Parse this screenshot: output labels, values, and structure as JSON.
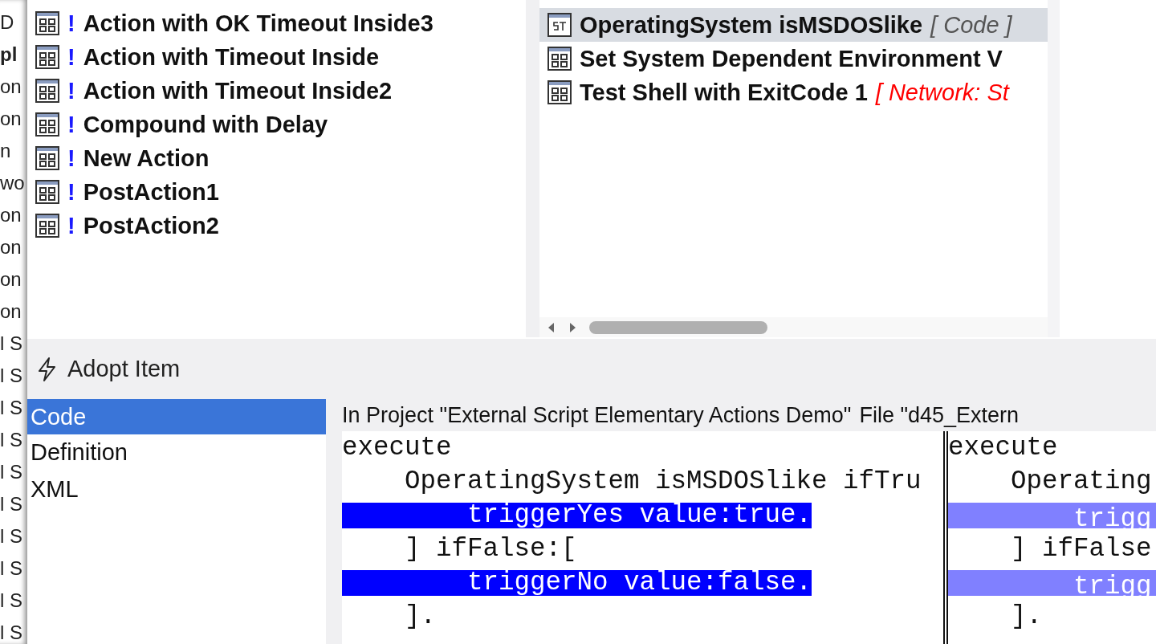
{
  "background_strip": [
    "D",
    "pl",
    "on",
    "on",
    "n",
    "wo",
    "on",
    "on",
    "on",
    "on",
    "l S",
    "l S",
    "l S",
    "l S",
    "l S",
    "l S",
    "l S",
    "l S",
    "l S",
    "l S"
  ],
  "actions_list": [
    {
      "label": "Action with OK Timeout Inside3",
      "marker": "!"
    },
    {
      "label": "Action with Timeout Inside",
      "marker": "!"
    },
    {
      "label": "Action with Timeout Inside2",
      "marker": "!"
    },
    {
      "label": "Compound with Delay",
      "marker": "!"
    },
    {
      "label": "New Action",
      "marker": "!"
    },
    {
      "label": "PostAction1",
      "marker": "!"
    },
    {
      "label": "PostAction2",
      "marker": "!"
    }
  ],
  "items_list": [
    {
      "kind": "script",
      "label": "OperatingSystem isMSDOSlike",
      "note": {
        "text": "[ Code ]",
        "color": "#555555"
      },
      "selected": true
    },
    {
      "kind": "compound",
      "label": "Set System Dependent Environment V",
      "selected": false
    },
    {
      "kind": "compound",
      "label": "Test Shell with ExitCode 1",
      "note": {
        "text": "[ Network: St",
        "color": "#ff0000"
      },
      "selected": false
    }
  ],
  "adopt_button": {
    "label": "Adopt Item"
  },
  "view_tabs": [
    {
      "label": "Code",
      "selected": true
    },
    {
      "label": "Definition",
      "selected": false
    },
    {
      "label": "XML",
      "selected": false
    }
  ],
  "source_labels": [
    "In Project \"External Script Elementary Actions Demo\"",
    "File \"d45_Extern"
  ],
  "code_panes": [
    {
      "lines": [
        {
          "text": "execute",
          "changed": false
        },
        {
          "text": "    OperatingSystem isMSDOSlike ifTru",
          "changed": false
        },
        {
          "text": "        triggerYes value:true.",
          "changed": true
        },
        {
          "text": "    ] ifFalse:[",
          "changed": false
        },
        {
          "text": "        triggerNo value:false.",
          "changed": true
        },
        {
          "text": "    ].",
          "changed": false
        }
      ]
    },
    {
      "lines": [
        {
          "text": "execute",
          "changed": false
        },
        {
          "text": "    Operating",
          "changed": false
        },
        {
          "text": "        trigg",
          "changed": true
        },
        {
          "text": "    ] ifFalse",
          "changed": false
        },
        {
          "text": "        trigg",
          "changed": true
        },
        {
          "text": "    ].",
          "changed": false
        }
      ]
    }
  ]
}
